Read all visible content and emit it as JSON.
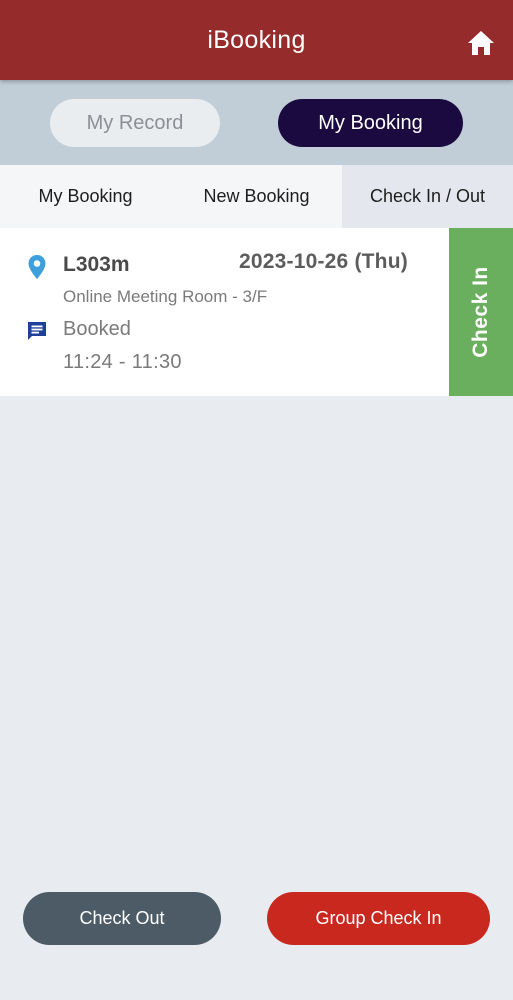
{
  "header": {
    "title": "iBooking",
    "home_icon": "home-icon"
  },
  "segment": {
    "record_label": "My Record",
    "booking_label": "My Booking",
    "active": "My Booking",
    "active_color": "#1a0a40"
  },
  "tabs": [
    {
      "label": "My Booking",
      "active": false
    },
    {
      "label": "New Booking",
      "active": false
    },
    {
      "label": "Check In / Out",
      "active": true
    }
  ],
  "booking": {
    "room_code": "L303m",
    "date": "2023-10-26 (Thu)",
    "room_name": "Online Meeting Room - 3/F",
    "status": "Booked",
    "time": "11:24 - 11:30",
    "check_in_label": "Check In",
    "check_in_color": "#6aaf5d",
    "location_icon": "location-pin-icon",
    "status_icon": "message-icon"
  },
  "footer": {
    "check_out_label": "Check Out",
    "group_check_in_label": "Group Check In"
  },
  "colors": {
    "header": "#962b2b",
    "check_out": "#4c5b66",
    "group_check_in": "#c8281e"
  }
}
